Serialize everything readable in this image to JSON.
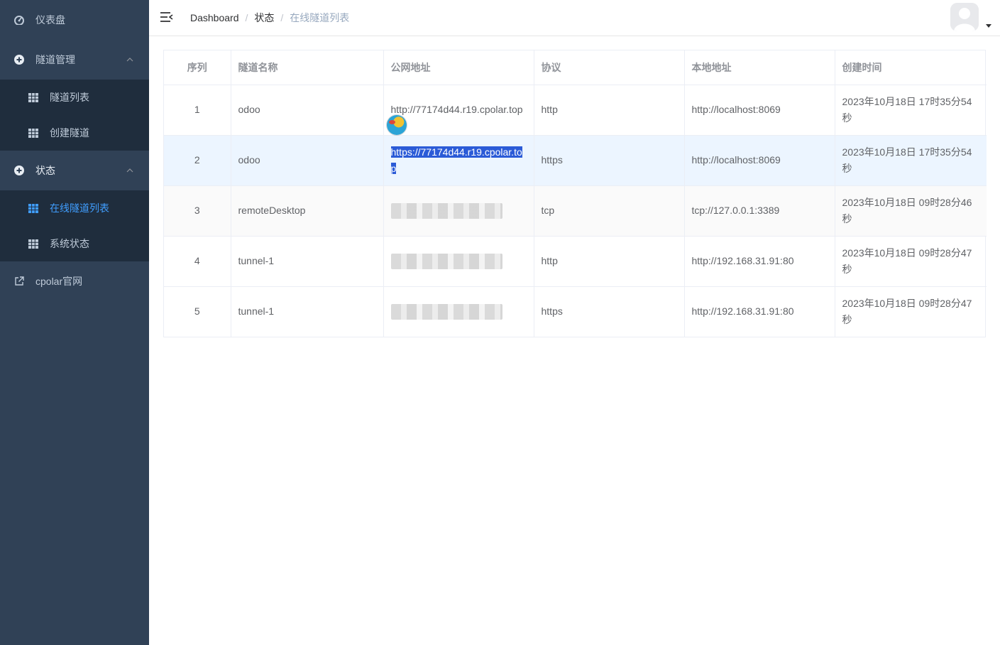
{
  "sidebar": {
    "dashboard": {
      "label": "仪表盘",
      "icon": "dashboard-icon"
    },
    "tunnel_mgmt": {
      "label": "隧道管理",
      "icon": "plus-circle-icon",
      "items": [
        {
          "label": "隧道列表",
          "icon": "table-icon"
        },
        {
          "label": "创建隧道",
          "icon": "table-icon"
        }
      ]
    },
    "status": {
      "label": "状态",
      "icon": "plus-circle-icon",
      "items": [
        {
          "label": "在线隧道列表",
          "icon": "table-icon",
          "active": true
        },
        {
          "label": "系统状态",
          "icon": "table-icon"
        }
      ]
    },
    "external": {
      "label": "cpolar官网",
      "icon": "external-link-icon"
    }
  },
  "header": {
    "breadcrumb": [
      "Dashboard",
      "状态",
      "在线隧道列表"
    ],
    "separator": "/"
  },
  "table": {
    "columns": [
      "序列",
      "隧道名称",
      "公网地址",
      "协议",
      "本地地址",
      "创建时间"
    ],
    "rows": [
      {
        "idx": "1",
        "name": "odoo",
        "public": "http://77174d44.r19.cpolar.top",
        "protocol": "http",
        "local": "http://localhost:8069",
        "created": "2023年10月18日 17时35分54秒"
      },
      {
        "idx": "2",
        "name": "odoo",
        "public": "https://77174d44.r19.cpolar.top",
        "protocol": "https",
        "local": "http://localhost:8069",
        "created": "2023年10月18日 17时35分54秒"
      },
      {
        "idx": "3",
        "name": "remoteDesktop",
        "public": "",
        "protocol": "tcp",
        "local": "tcp://127.0.0.1:3389",
        "created": "2023年10月18日 09时28分46秒"
      },
      {
        "idx": "4",
        "name": "tunnel-1",
        "public": "",
        "protocol": "http",
        "local": "http://192.168.31.91:80",
        "created": "2023年10月18日 09时28分47秒"
      },
      {
        "idx": "5",
        "name": "tunnel-1",
        "public": "",
        "protocol": "https",
        "local": "http://192.168.31.91:80",
        "created": "2023年10月18日 09时28分47秒"
      }
    ]
  },
  "colors": {
    "sidebar_bg": "#304156",
    "submenu_bg": "#1f2d3d",
    "active": "#409eff",
    "selection": "#2b5bd7"
  }
}
